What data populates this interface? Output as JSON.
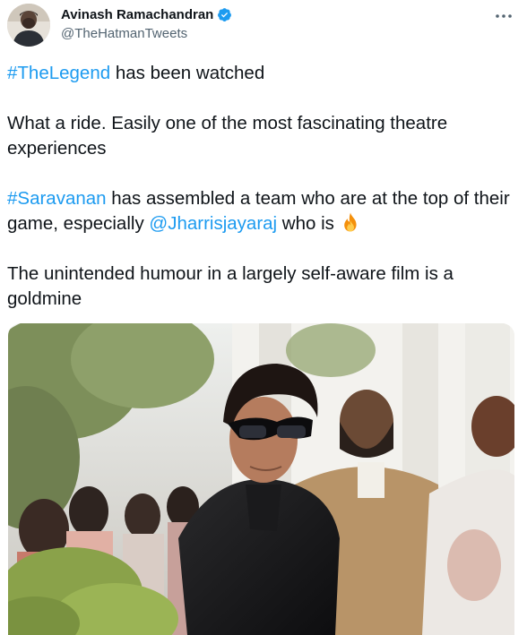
{
  "author": {
    "display_name": "Avinash Ramachandran",
    "handle": "@TheHatmanTweets",
    "verified": true,
    "verified_icon": "verified-badge-icon",
    "avatar_icon": "avatar"
  },
  "more_icon": "more-options-icon",
  "tweet": {
    "p1": {
      "hashtag": "#TheLegend",
      "rest": " has been watched"
    },
    "p2": "What a ride. Easily one of the most fascinating theatre experiences",
    "p3": {
      "hashtag": "#Saravanan",
      "mid": " has assembled a team who are at the top of their game, especially ",
      "mention": "@Jharrisjayaraj",
      "end": " who is ",
      "emoji": "fire-emoji"
    },
    "p4": "The unintended humour in a largely self-aware film is a goldmine"
  },
  "media": {
    "type": "photo",
    "description_icon": "tweet-photo"
  },
  "colors": {
    "link": "#1d9bf0",
    "text": "#0f1419",
    "secondary": "#536471",
    "verified": "#1d9bf0"
  }
}
